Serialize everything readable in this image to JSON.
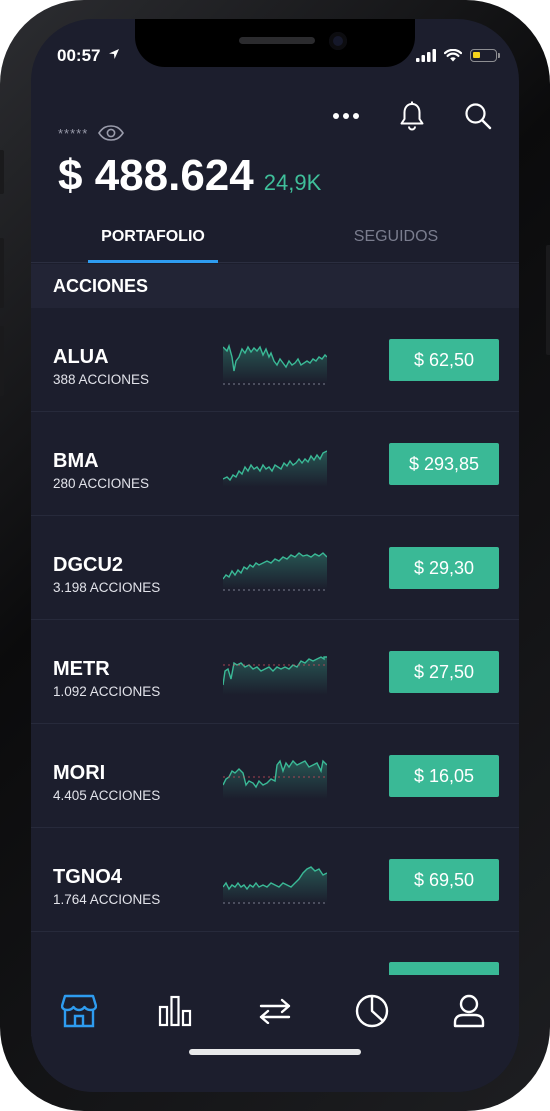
{
  "status_bar": {
    "time": "00:57"
  },
  "header": {
    "masked_value": "*****",
    "balance": "$ 488.624",
    "change": "24,9K"
  },
  "tabs": [
    {
      "label": "PORTAFOLIO",
      "active": true
    },
    {
      "label": "SEGUIDOS",
      "active": false
    }
  ],
  "section": {
    "title": "ACCIONES"
  },
  "stocks": [
    {
      "ticker": "ALUA",
      "quantity": "388 ACCIONES",
      "price": "$ 62,50"
    },
    {
      "ticker": "BMA",
      "quantity": "280 ACCIONES",
      "price": "$ 293,85"
    },
    {
      "ticker": "DGCU2",
      "quantity": "3.198 ACCIONES",
      "price": "$ 29,30"
    },
    {
      "ticker": "METR",
      "quantity": "1.092 ACCIONES",
      "price": "$ 27,50"
    },
    {
      "ticker": "MORI",
      "quantity": "4.405 ACCIONES",
      "price": "$ 16,05"
    },
    {
      "ticker": "TGNO4",
      "quantity": "1.764 ACCIONES",
      "price": "$ 69,50"
    }
  ],
  "bottom_nav": [
    {
      "icon": "store-icon",
      "active": true
    },
    {
      "icon": "bar-chart-icon",
      "active": false
    },
    {
      "icon": "transfer-icon",
      "active": false
    },
    {
      "icon": "pie-chart-icon",
      "active": false
    },
    {
      "icon": "user-icon",
      "active": false
    }
  ],
  "colors": {
    "background": "#1c1e2d",
    "accent_green": "#3ab996",
    "accent_blue": "#2e9cf0",
    "battery_yellow": "#f4d21c"
  }
}
